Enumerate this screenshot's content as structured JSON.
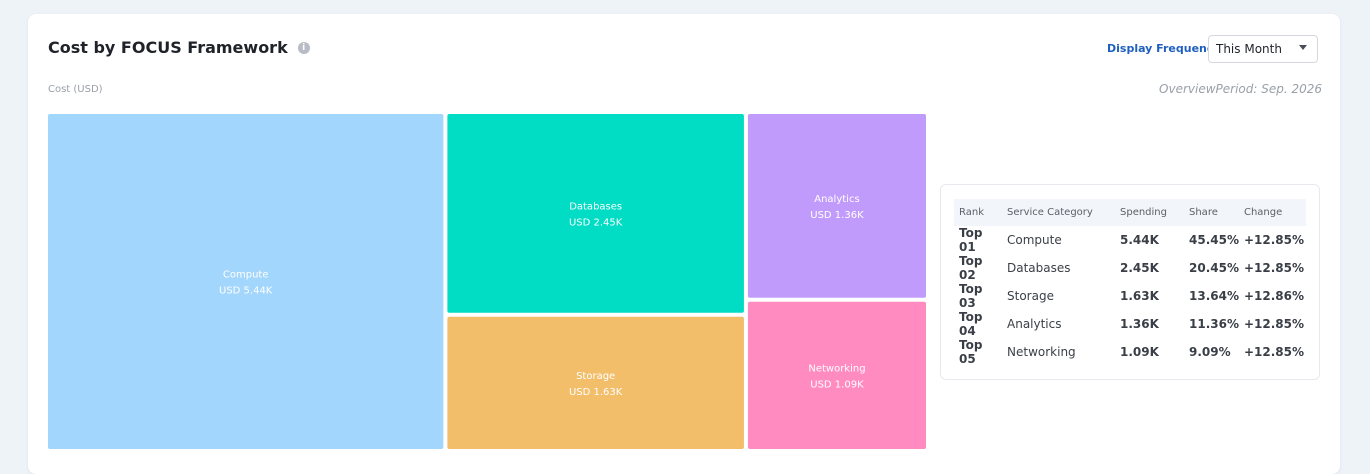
{
  "header": {
    "title": "Cost by FOCUS Framework",
    "info_glyph": "i",
    "frequency_label": "Display Frequency",
    "frequency_value": "This Month"
  },
  "period_text": "OverviewPeriod: Sep. 2026",
  "colors": {
    "Compute": "#a3d6fc",
    "Databases": "#00ddc4",
    "Storage": "#f2be6a",
    "Analytics": "#c19bfc",
    "Networking": "#ff8bc1"
  },
  "chart_data": {
    "type": "treemap",
    "ylabel": "Cost (USD)",
    "items": [
      {
        "name": "Compute",
        "value": 5.44,
        "label": "USD 5.44K"
      },
      {
        "name": "Databases",
        "value": 2.45,
        "label": "USD 2.45K"
      },
      {
        "name": "Storage",
        "value": 1.63,
        "label": "USD 1.63K"
      },
      {
        "name": "Analytics",
        "value": 1.36,
        "label": "USD 1.36K"
      },
      {
        "name": "Networking",
        "value": 1.09,
        "label": "USD 1.09K"
      }
    ]
  },
  "ranking": {
    "columns": [
      "Rank",
      "Service Category",
      "Spending",
      "Share",
      "Change"
    ],
    "rows": [
      {
        "rank": "Top 01",
        "category": "Compute",
        "spending": "5.44K",
        "share": "45.45%",
        "change": "+12.85%"
      },
      {
        "rank": "Top 02",
        "category": "Databases",
        "spending": "2.45K",
        "share": "20.45%",
        "change": "+12.85%"
      },
      {
        "rank": "Top 03",
        "category": "Storage",
        "spending": "1.63K",
        "share": "13.64%",
        "change": "+12.86%"
      },
      {
        "rank": "Top 04",
        "category": "Analytics",
        "spending": "1.36K",
        "share": "11.36%",
        "change": "+12.85%"
      },
      {
        "rank": "Top 05",
        "category": "Networking",
        "spending": "1.09K",
        "share": "9.09%",
        "change": "+12.85%"
      }
    ]
  }
}
